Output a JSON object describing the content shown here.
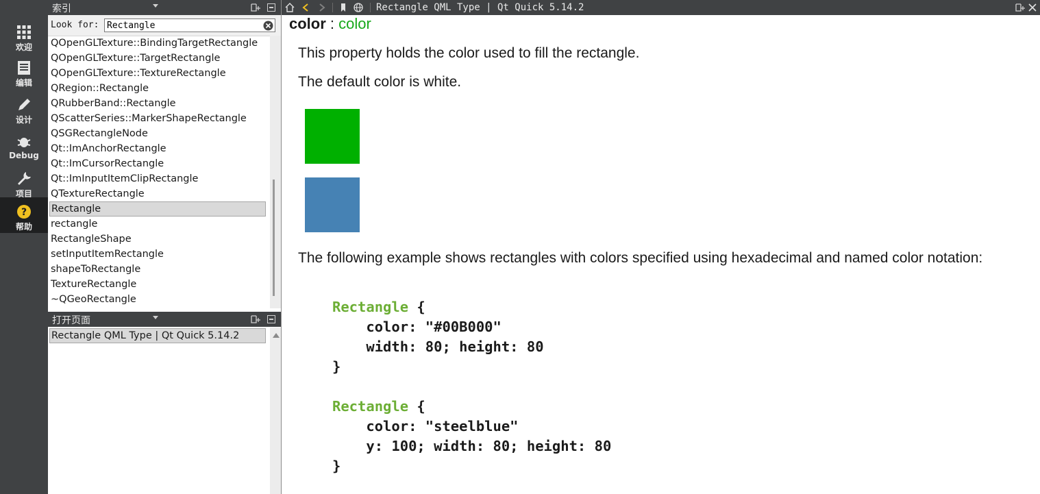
{
  "modebar": {
    "modes": [
      {
        "label": "欢迎",
        "icon": "grid-icon"
      },
      {
        "label": "编辑",
        "icon": "document-icon"
      },
      {
        "label": "设计",
        "icon": "pen-icon"
      },
      {
        "label": "Debug",
        "icon": "bug-icon"
      },
      {
        "label": "项目",
        "icon": "wrench-icon"
      },
      {
        "label": "帮助",
        "icon": "help-icon",
        "active": true
      }
    ]
  },
  "index_pane": {
    "header_title": "索引",
    "look_for_label": "Look for:",
    "search_value": "Rectangle",
    "results": [
      "QOpenGLTexture::BindingTargetRectangle",
      "QOpenGLTexture::TargetRectangle",
      "QOpenGLTexture::TextureRectangle",
      "QRegion::Rectangle",
      "QRubberBand::Rectangle",
      "QScatterSeries::MarkerShapeRectangle",
      "QSGRectangleNode",
      "Qt::ImAnchorRectangle",
      "Qt::ImCursorRectangle",
      "Qt::ImInputItemClipRectangle",
      "QTextureRectangle",
      "Rectangle",
      "rectangle",
      "RectangleShape",
      "setInputItemRectangle",
      "shapeToRectangle",
      "TextureRectangle",
      "~QGeoRectangle"
    ],
    "selected_result": "Rectangle"
  },
  "open_pages": {
    "header_title": "打开页面",
    "pages": [
      "Rectangle QML Type | Qt Quick 5.14.2"
    ]
  },
  "toolbar": {
    "title": "Rectangle QML Type | Qt Quick 5.14.2",
    "icons": [
      "home-icon",
      "back-icon",
      "forward-icon",
      "bookmark-icon",
      "globe-icon",
      "split-icon",
      "close-icon"
    ]
  },
  "content": {
    "property_name": "color",
    "property_sep": " : ",
    "property_type": "color",
    "para1": "This property holds the color used to fill the rectangle.",
    "para2": "The default color is white.",
    "para3": "The following example shows rectangles with colors specified using hexadecimal and named color notation:",
    "swatches": [
      "#00B000",
      "steelblue"
    ],
    "swatch_colors": [
      "#00B000",
      "#4682B4"
    ],
    "code_block_1": {
      "type": "Rectangle",
      "open": " {",
      "lines": [
        "    color: \"#00B000\"",
        "    width: 80; height: 80",
        "}"
      ]
    },
    "code_block_2": {
      "type": "Rectangle",
      "open": " {",
      "lines": [
        "    color: \"steelblue\"",
        "    y: 100; width: 80; height: 80",
        "}"
      ]
    }
  },
  "colors": {
    "sidebar_bg": "#404244",
    "active_mode_bg": "#1f2021",
    "qml_type_green": "#6cae35",
    "property_type_green": "#17a81a"
  }
}
